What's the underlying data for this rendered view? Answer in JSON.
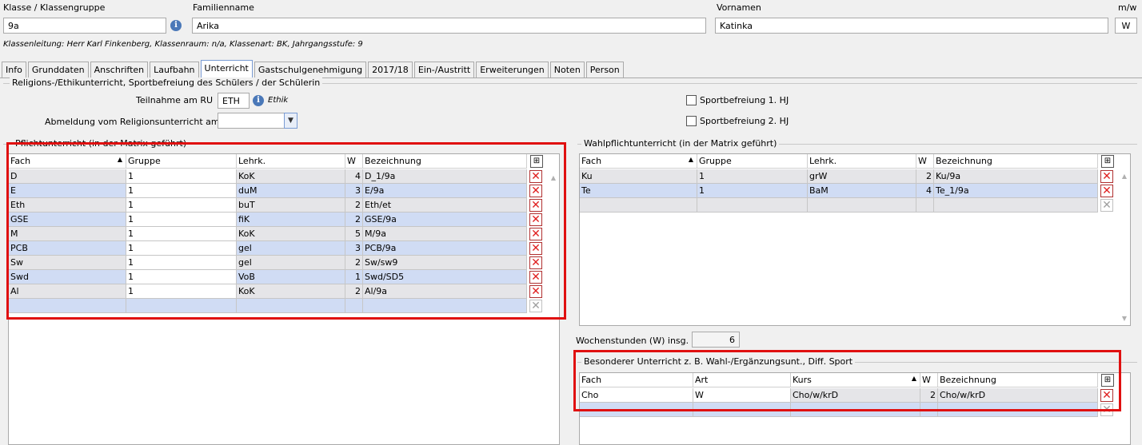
{
  "header": {
    "klasse_label": "Klasse / Klassengruppe",
    "klasse_value": "9a",
    "familienname_label": "Familienname",
    "familienname_value": "Arika",
    "vornamen_label": "Vornamen",
    "vornamen_value": "Katinka",
    "mw_label": "m/w",
    "mw_value": "W",
    "info_line": "Klassenleitung: Herr Karl Finkenberg, Klassenraum: n/a, Klassenart: BK, Jahrgangsstufe: 9"
  },
  "tabs": [
    "Info",
    "Grunddaten",
    "Anschriften",
    "Laufbahn",
    "Unterricht",
    "Gastschulgenehmigung",
    "2017/18",
    "Ein-/Austritt",
    "Erweiterungen",
    "Noten",
    "Person"
  ],
  "active_tab": "Unterricht",
  "religion": {
    "group_title": "Religions-/Ethikunterricht, Sportbefreiung des Schülers / der Schülerin",
    "teilnahme_label": "Teilnahme am RU",
    "teilnahme_value": "ETH",
    "teilnahme_hint": "Ethik",
    "abmeldung_label": "Abmeldung vom Religionsunterricht am",
    "abmeldung_value": "",
    "sport1_label": "Sportbefreiung 1. HJ",
    "sport2_label": "Sportbefreiung 2. HJ"
  },
  "pflicht": {
    "title": "Pflichtunterricht (in der Matrix geführt)",
    "columns": [
      "Fach",
      "Gruppe",
      "Lehrk.",
      "W",
      "Bezeichnung"
    ],
    "rows": [
      [
        "D",
        "1",
        "KoK",
        "4",
        "D_1/9a"
      ],
      [
        "E",
        "1",
        "duM",
        "3",
        "E/9a"
      ],
      [
        "Eth",
        "1",
        "buT",
        "2",
        "Eth/et"
      ],
      [
        "GSE",
        "1",
        "fiK",
        "2",
        "GSE/9a"
      ],
      [
        "M",
        "1",
        "KoK",
        "5",
        "M/9a"
      ],
      [
        "PCB",
        "1",
        "gel",
        "3",
        "PCB/9a"
      ],
      [
        "Sw",
        "1",
        "gel",
        "2",
        "Sw/sw9"
      ],
      [
        "Swd",
        "1",
        "VoB",
        "1",
        "Swd/SD5"
      ],
      [
        "Al",
        "1",
        "KoK",
        "2",
        "Al/9a"
      ]
    ]
  },
  "wahlpflicht": {
    "title": "Wahlpflichtunterricht (in der Matrix geführt)",
    "columns": [
      "Fach",
      "Gruppe",
      "Lehrk.",
      "W",
      "Bezeichnung"
    ],
    "rows": [
      [
        "Ku",
        "1",
        "grW",
        "2",
        "Ku/9a"
      ],
      [
        "Te",
        "1",
        "BaM",
        "4",
        "Te_1/9a"
      ]
    ]
  },
  "wochenstunden": {
    "label": "Wochenstunden (W) insg.",
    "value": "6"
  },
  "besonderer": {
    "title": "Besonderer Unterricht z. B. Wahl-/Ergänzungsunt., Diff. Sport",
    "columns": [
      "Fach",
      "Art",
      "Kurs",
      "W",
      "Bezeichnung"
    ],
    "rows": [
      [
        "Cho",
        "W",
        "Cho/w/krD",
        "2",
        "Cho/w/krD"
      ]
    ]
  },
  "colors": {
    "highlight_box": "#e01010",
    "row_alt": "#d0dcf4",
    "row_base": "#e5e5e8",
    "delete_icon": "#e02020",
    "info_icon": "#4a78b8"
  }
}
